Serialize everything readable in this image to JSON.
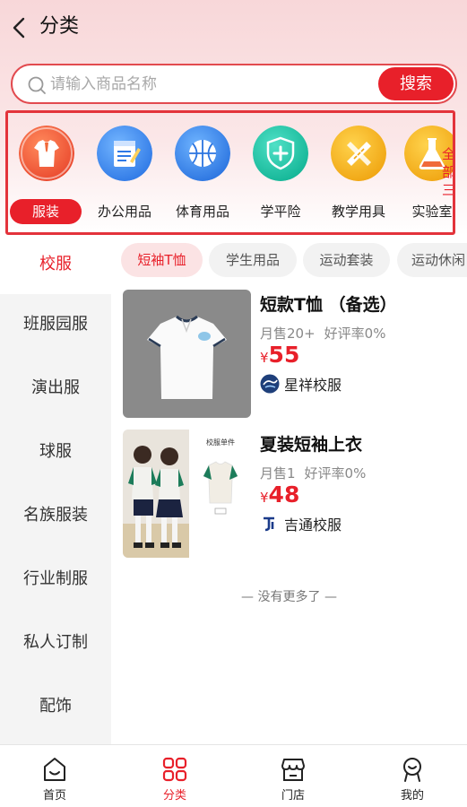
{
  "header": {
    "title": "分类",
    "back_icon": "chevron-left-icon"
  },
  "search": {
    "placeholder": "请输入商品名称",
    "button_label": "搜索",
    "icon": "search-icon"
  },
  "categories": [
    {
      "label": "服装",
      "icon": "tshirt-icon",
      "active": true
    },
    {
      "label": "办公用品",
      "icon": "notepad-icon"
    },
    {
      "label": "体育用品",
      "icon": "basketball-icon"
    },
    {
      "label": "学平险",
      "icon": "shield-plus-icon"
    },
    {
      "label": "教学用具",
      "icon": "ruler-pencil-icon"
    },
    {
      "label": "实验室",
      "icon": "flask-icon"
    }
  ],
  "categories_more_label": "全部三",
  "sidebar": {
    "items": [
      {
        "label": "校服",
        "active": true
      },
      {
        "label": "班服园服"
      },
      {
        "label": "演出服"
      },
      {
        "label": "球服"
      },
      {
        "label": "名族服装"
      },
      {
        "label": "行业制服"
      },
      {
        "label": "私人订制"
      },
      {
        "label": "配饰"
      }
    ]
  },
  "subtabs": [
    {
      "label": "短袖T恤",
      "active": true
    },
    {
      "label": "学生用品"
    },
    {
      "label": "运动套装"
    },
    {
      "label": "运动休闲"
    }
  ],
  "products": [
    {
      "title": "短款T恤 （备选）",
      "sales": "月售20+",
      "rating": "好评率0%",
      "currency": "¥",
      "price": "55",
      "shop": "星祥校服"
    },
    {
      "title": "夏装短袖上衣",
      "sales": "月售1",
      "rating": "好评率0%",
      "currency": "¥",
      "price": "48",
      "shop": "吉通校服",
      "image_caption": "校服单件"
    }
  ],
  "list_end_text": "— 没有更多了 —",
  "tabbar": [
    {
      "label": "首页",
      "icon": "home-icon"
    },
    {
      "label": "分类",
      "icon": "category-grid-icon",
      "active": true
    },
    {
      "label": "门店",
      "icon": "store-icon"
    },
    {
      "label": "我的",
      "icon": "user-icon"
    }
  ],
  "colors": {
    "accent": "#e8202a",
    "accent_light": "#fbe3e4",
    "sidebar_bg": "#f4f4f4",
    "header_gradient_top": "#f8d7d9"
  }
}
